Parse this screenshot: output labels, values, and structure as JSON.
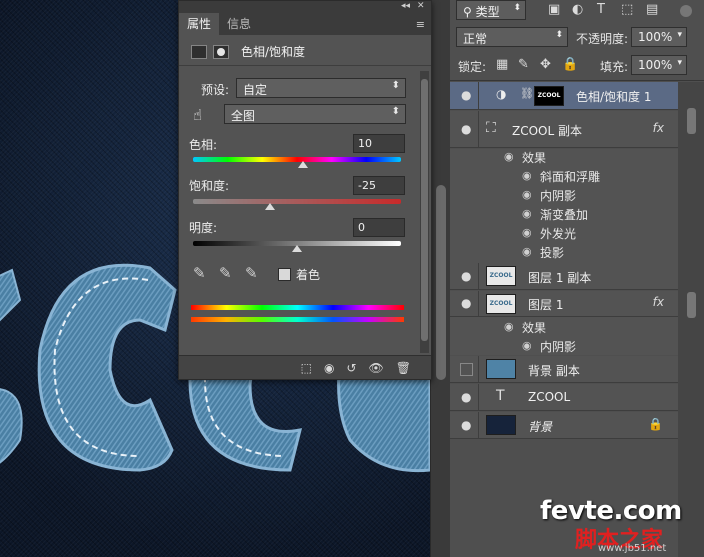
{
  "properties_panel": {
    "tabs": [
      "属性",
      "信息"
    ],
    "adjustment_title": "色相/饱和度",
    "preset_label": "预设:",
    "preset_value": "自定",
    "channel_value": "全图",
    "hue_label": "色相:",
    "hue_value": "10",
    "saturation_label": "饱和度:",
    "saturation_value": "-25",
    "lightness_label": "明度:",
    "lightness_value": "0",
    "colorize_label": "着色",
    "hue_slider_fraction": 0.53,
    "saturation_slider_fraction": 0.37,
    "lightness_slider_fraction": 0.5
  },
  "layers_panel": {
    "kind_filter": "类型",
    "blend_mode": "正常",
    "opacity_label": "不透明度:",
    "opacity_value": "100%",
    "lock_label": "锁定:",
    "fill_label": "填充:",
    "fill_value": "100%",
    "layers": [
      {
        "name": "色相/饱和度 1",
        "thumb_text": "ZCOOL",
        "selected": true
      },
      {
        "name": "ZCOOL 副本",
        "fx": "fx"
      },
      {
        "effects_label": "效果"
      },
      {
        "effect": "斜面和浮雕"
      },
      {
        "effect": "内阴影"
      },
      {
        "effect": "渐变叠加"
      },
      {
        "effect": "外发光"
      },
      {
        "effect": "投影"
      },
      {
        "name": "图层 1 副本",
        "thumb_text": "ZCOOL"
      },
      {
        "name": "图层 1",
        "thumb_text": "ZCOOL",
        "fx": "fx"
      },
      {
        "effects_label": "效果"
      },
      {
        "effect": "内阴影"
      },
      {
        "name": "背景 副本"
      },
      {
        "name": "ZCOOL"
      },
      {
        "name": "背景"
      }
    ]
  },
  "watermark": {
    "line1": "fevte.com",
    "line2": "脚本之家",
    "line3": "www.jb51.net"
  },
  "colors": {
    "accent_selected": "#5b6a85",
    "panel_bg": "#535353",
    "denim": "#4f83a6"
  }
}
